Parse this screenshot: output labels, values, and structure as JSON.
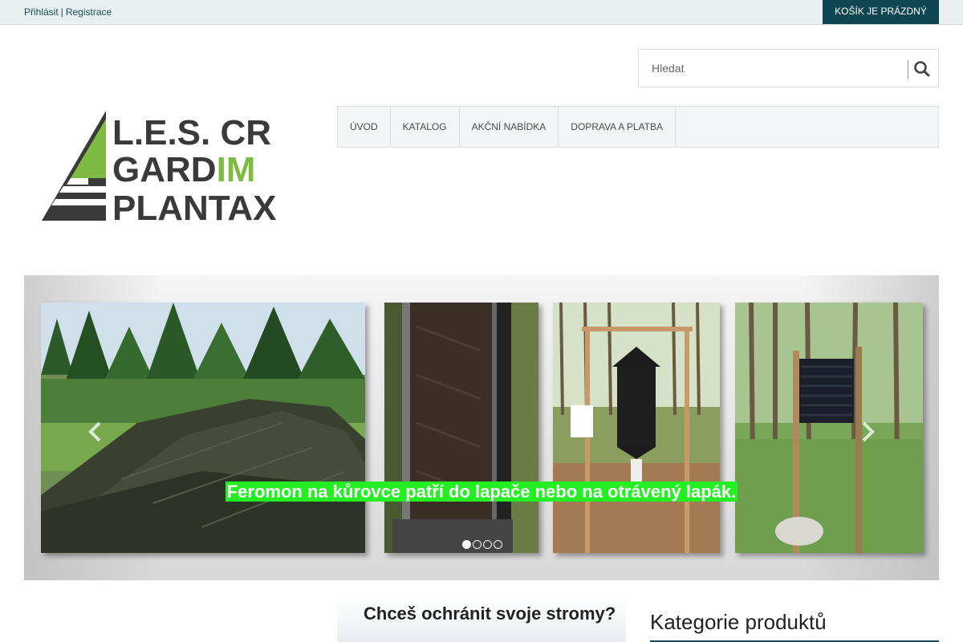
{
  "header": {
    "login_label": "Přihlásit",
    "separator": "|",
    "register_label": "Registrace",
    "cart_label": "KOŠÍK JE PRÁZDNÝ"
  },
  "search": {
    "placeholder": "Hledat",
    "icon": "search-icon"
  },
  "logo": {
    "line1": "L.E.S. CR",
    "line2_a": "GARD",
    "line2_b": "IM",
    "line3": "PLANTAX",
    "accent_color": "#7dbb42",
    "dark_color": "#3a3a3a"
  },
  "nav": {
    "items": [
      {
        "label": "ÚVOD"
      },
      {
        "label": "KATALOG"
      },
      {
        "label": "AKČNÍ NABÍDKA"
      },
      {
        "label": "DOPRAVA A PLATBA"
      }
    ]
  },
  "carousel": {
    "caption": "Feromon na kůrovce patří do lapače nebo na otrávený lapák.",
    "slide_count": 4,
    "active_slide": 1,
    "caption_bg": "#22f022"
  },
  "promo": {
    "text": "Chceš ochránit svoje stromy?"
  },
  "sidebar": {
    "categories_title": "Kategorie produktů"
  },
  "colors": {
    "cart_bg": "#0f4550",
    "topbar_bg": "#e8f0f1"
  }
}
